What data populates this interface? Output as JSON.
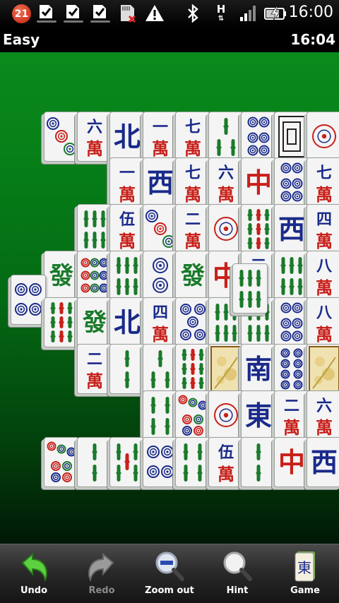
{
  "status_bar": {
    "notification_count": "21",
    "clock": "16:00",
    "network_type": "H",
    "icons": [
      "task-checkbox-icon",
      "task-checkbox-icon",
      "task-checkbox-icon",
      "sd-card-error-icon",
      "warning-icon",
      "bluetooth-icon",
      "signal-icon",
      "battery-charging-icon"
    ]
  },
  "title_bar": {
    "difficulty": "Easy",
    "game_timer": "16:04"
  },
  "colors": {
    "felt": "#068018",
    "tile_face": "#f4f4f4",
    "char_red": "#c8201a",
    "char_blue": "#1a2a8a",
    "bamboo_green": "#1a7a2a"
  },
  "tiles": [
    {
      "kind": "circles",
      "value": "3"
    },
    {
      "kind": "character",
      "value": "六"
    },
    {
      "kind": "wind",
      "value": "北"
    },
    {
      "kind": "character",
      "value": "一"
    },
    {
      "kind": "character",
      "value": "七"
    },
    {
      "kind": "bamboo",
      "value": "3"
    },
    {
      "kind": "circles",
      "value": "6"
    },
    {
      "kind": "dragon",
      "value": "白"
    },
    {
      "kind": "circles",
      "value": "1"
    },
    {
      "kind": "character",
      "value": "一"
    },
    {
      "kind": "wind",
      "value": "西"
    },
    {
      "kind": "character",
      "value": "七"
    },
    {
      "kind": "character",
      "value": "六"
    },
    {
      "kind": "dragon",
      "value": "中"
    },
    {
      "kind": "circles",
      "value": "6"
    },
    {
      "kind": "character",
      "value": "七"
    },
    {
      "kind": "bamboo",
      "value": "6"
    },
    {
      "kind": "character",
      "value": "伍"
    },
    {
      "kind": "circles",
      "value": "3"
    },
    {
      "kind": "character",
      "value": "二"
    },
    {
      "kind": "circles",
      "value": "1"
    },
    {
      "kind": "bamboo",
      "value": "9"
    },
    {
      "kind": "wind",
      "value": "西"
    },
    {
      "kind": "character",
      "value": "四"
    },
    {
      "kind": "dragon",
      "value": "發"
    },
    {
      "kind": "circles",
      "value": "9"
    },
    {
      "kind": "bamboo",
      "value": "6"
    },
    {
      "kind": "circles",
      "value": "2"
    },
    {
      "kind": "dragon",
      "value": "發"
    },
    {
      "kind": "dragon",
      "value": "中"
    },
    {
      "kind": "character",
      "value": "三"
    },
    {
      "kind": "bamboo",
      "value": "6"
    },
    {
      "kind": "character",
      "value": "八"
    },
    {
      "kind": "circles",
      "value": "4"
    },
    {
      "kind": "bamboo",
      "value": "9"
    },
    {
      "kind": "dragon",
      "value": "發"
    },
    {
      "kind": "wind",
      "value": "北"
    },
    {
      "kind": "character",
      "value": "四"
    },
    {
      "kind": "circles",
      "value": "5"
    },
    {
      "kind": "bamboo",
      "value": "6"
    },
    {
      "kind": "bamboo",
      "value": "6"
    },
    {
      "kind": "circles",
      "value": "6"
    },
    {
      "kind": "character",
      "value": "八"
    },
    {
      "kind": "character",
      "value": "二"
    },
    {
      "kind": "bamboo",
      "value": "2"
    },
    {
      "kind": "bamboo",
      "value": "3"
    },
    {
      "kind": "bamboo",
      "value": "9"
    },
    {
      "kind": "flower",
      "value": "flower"
    },
    {
      "kind": "wind",
      "value": "南"
    },
    {
      "kind": "circles",
      "value": "8"
    },
    {
      "kind": "flower",
      "value": "flower"
    },
    {
      "kind": "bamboo",
      "value": "4"
    },
    {
      "kind": "circles",
      "value": "7"
    },
    {
      "kind": "circles",
      "value": "1"
    },
    {
      "kind": "wind",
      "value": "東"
    },
    {
      "kind": "character",
      "value": "二"
    },
    {
      "kind": "character",
      "value": "六"
    },
    {
      "kind": "circles",
      "value": "7"
    },
    {
      "kind": "bamboo",
      "value": "2"
    },
    {
      "kind": "bamboo",
      "value": "5"
    },
    {
      "kind": "circles",
      "value": "4"
    },
    {
      "kind": "bamboo",
      "value": "4"
    },
    {
      "kind": "character",
      "value": "伍"
    },
    {
      "kind": "bamboo",
      "value": "2"
    },
    {
      "kind": "dragon",
      "value": "中"
    },
    {
      "kind": "wind",
      "value": "西"
    },
    {
      "kind": "bamboo",
      "value": "6"
    }
  ],
  "character_suffix": "萬",
  "toolbar": {
    "buttons": [
      {
        "label": "Undo",
        "icon": "undo-arrow-icon",
        "enabled": true
      },
      {
        "label": "Redo",
        "icon": "redo-arrow-icon",
        "enabled": false
      },
      {
        "label": "Zoom out",
        "icon": "zoom-out-icon",
        "enabled": true
      },
      {
        "label": "Hint",
        "icon": "hint-magnifier-icon",
        "enabled": true
      },
      {
        "label": "Game",
        "icon": "mahjong-tile-icon",
        "enabled": true
      }
    ]
  }
}
